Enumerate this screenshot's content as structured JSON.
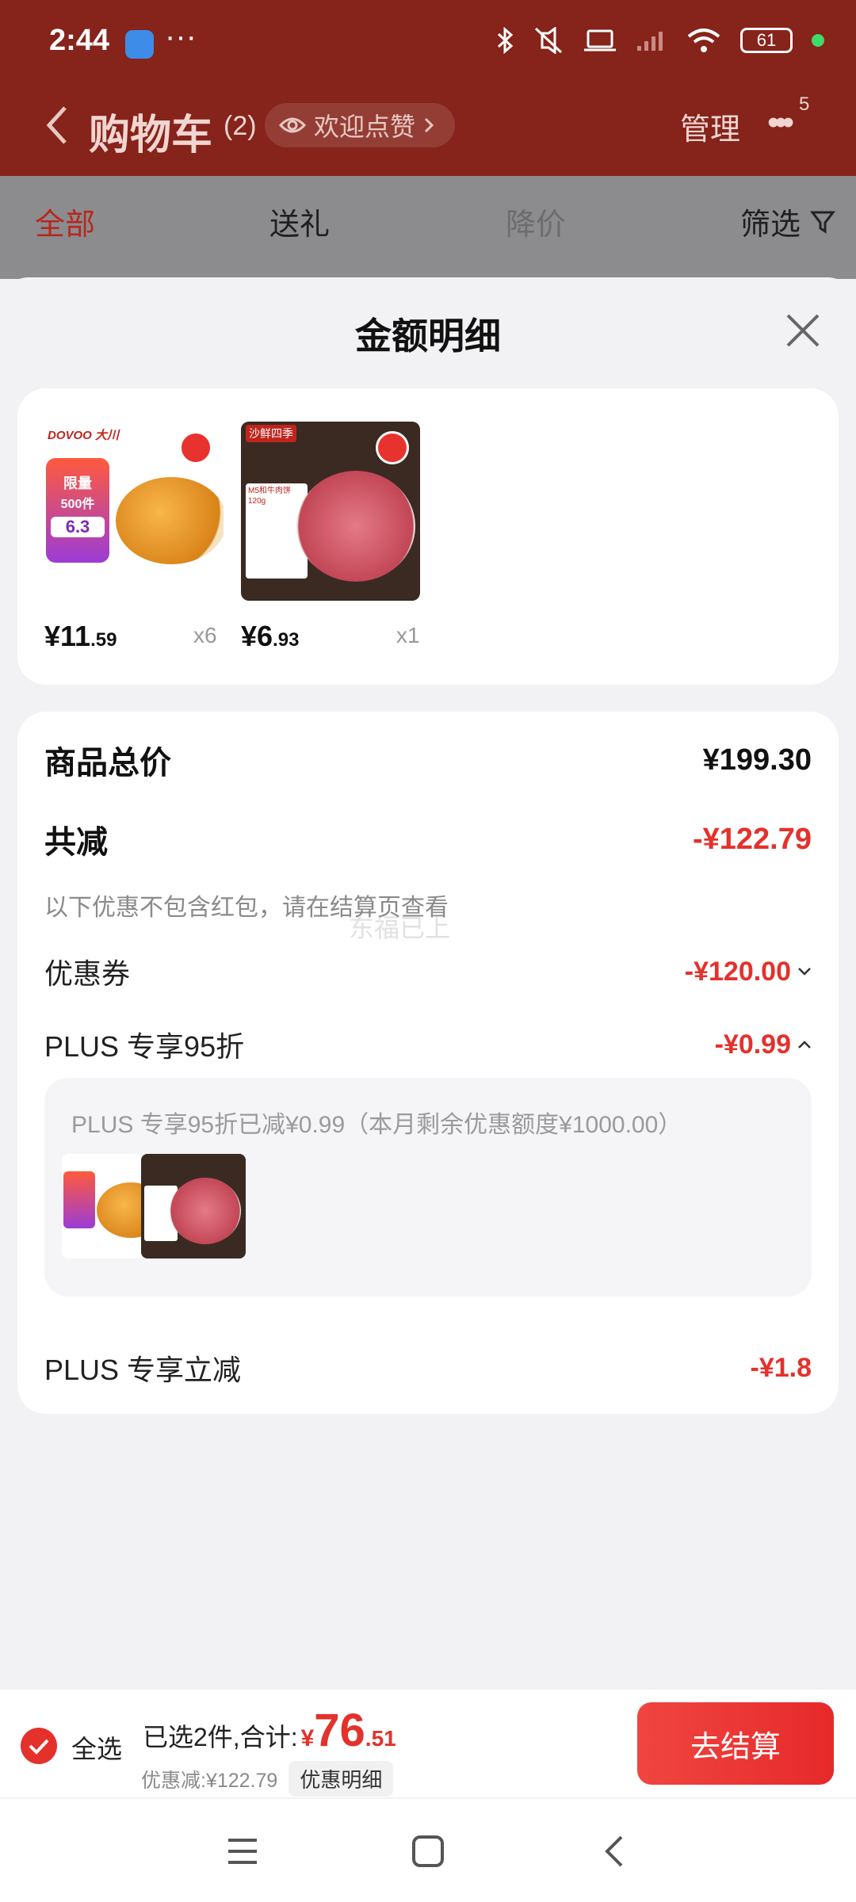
{
  "status": {
    "time": "2:44",
    "more": "···",
    "battery": "61"
  },
  "nav": {
    "title": "购物车",
    "count": "(2)",
    "pill": "欢迎点赞",
    "manage": "管理",
    "more_badge": "5"
  },
  "tabs": [
    {
      "label": "全部"
    },
    {
      "label": "送礼"
    },
    {
      "label": "降价"
    },
    {
      "label": "筛选"
    }
  ],
  "sheet": {
    "title": "金额明细"
  },
  "products": [
    {
      "brand": "DOVOO 大川",
      "promo": "限量",
      "promo2": "500件",
      "promo_price": "6.3",
      "price_int": "¥11",
      "price_dec": ".59",
      "qty": "x6"
    },
    {
      "tag": "沙鲜四季",
      "label": "M5和牛肉饼120g",
      "price_int": "¥6",
      "price_dec": ".93",
      "qty": "x1"
    }
  ],
  "detail": {
    "total_label": "商品总价",
    "total_value": "¥199.30",
    "reduce_label": "共减",
    "reduce_value": "-¥122.79",
    "note": "以下优惠不包含红包，请在结算页查看",
    "watermark": "东福已上",
    "coupon_label": "优惠券",
    "coupon_value": "-¥120.00",
    "plus95_label": "PLUS 专享95折",
    "plus95_value": "-¥0.99",
    "plus95_note": "PLUS 专享95折已减¥0.99（本月剩余优惠额度¥1000.00）",
    "plus_cut_label": "PLUS 专享立减",
    "plus_cut_value": "-¥1.8"
  },
  "checkout": {
    "select_all": "全选",
    "summary": "已选2件,合计:",
    "yen": "¥",
    "total_int": "76",
    "total_dec": ".51",
    "discount": "优惠减:¥122.79",
    "discount_btn": "优惠明细",
    "pay": "去结算"
  },
  "colors": {
    "accent": "#e4312b",
    "header": "#86231a"
  }
}
